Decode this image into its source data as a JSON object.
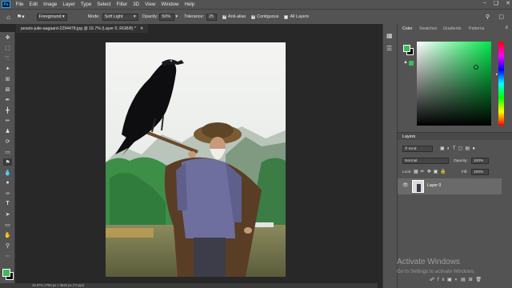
{
  "menu": {
    "items": [
      "File",
      "Edit",
      "Image",
      "Layer",
      "Type",
      "Select",
      "Filter",
      "3D",
      "View",
      "Window",
      "Help"
    ],
    "logo": "Ps"
  },
  "options": {
    "brush_target": "Foreground",
    "mode_label": "Mode:",
    "mode_value": "Soft Light",
    "opacity_label": "Opacity:",
    "opacity_value": "50%",
    "tolerance_label": "Tolerance:",
    "tolerance_value": "25",
    "antialias_label": "Anti-alias",
    "contiguous_label": "Contiguous",
    "all_layers_label": "All Layers"
  },
  "document": {
    "tab_title": "pexels-julie-aagaard-2294478.jpg @ 16.7% (Layer 0, RGB/8) *",
    "status": "16.67%   2794 px x 3642 px (72 ppi)"
  },
  "color_panel": {
    "tabs": [
      "Color",
      "Swatches",
      "Gradients",
      "Patterns"
    ],
    "active_tab": "Color",
    "foreground_color": "#3dba5c",
    "hue_color": "#00e84a"
  },
  "layers_panel": {
    "title": "Layers",
    "filter_label": "Kind",
    "blend_mode": "Normal",
    "opacity_label": "Opacity:",
    "opacity_value": "100%",
    "lock_label": "Lock:",
    "fill_label": "Fill:",
    "fill_value": "100%",
    "layers": [
      {
        "name": "Layer 0",
        "visible": true
      }
    ]
  },
  "watermark": {
    "line1": "Activate Windows",
    "line2": "Go to Settings to activate Windows."
  }
}
